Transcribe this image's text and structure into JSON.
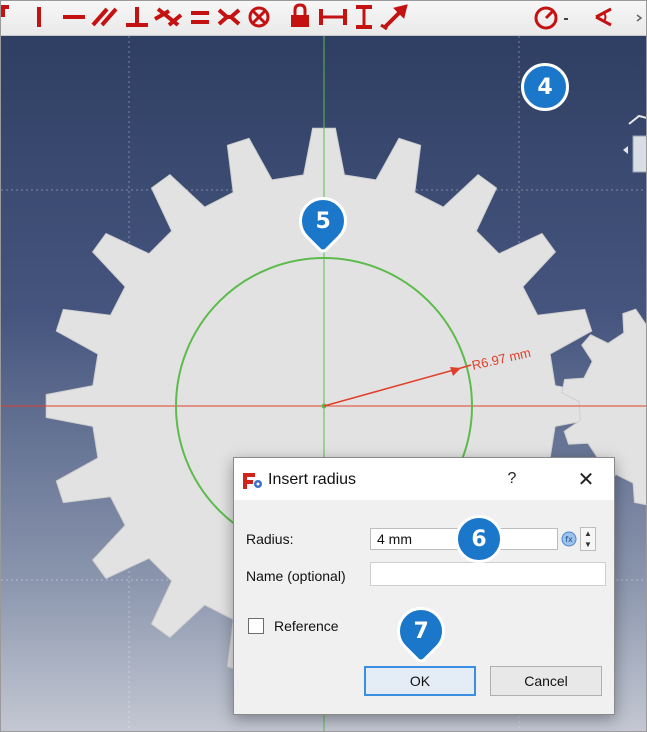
{
  "toolbar": {
    "icons": [
      "arc-fragment-icon",
      "vertical-constraint-icon",
      "horizontal-constraint-icon",
      "parallel-constraint-icon",
      "perpendicular-constraint-icon",
      "tangent-constraint-icon",
      "equal-constraint-icon",
      "symmetric-constraint-icon",
      "block-constraint-icon",
      "lock-constraint-icon",
      "horizontal-distance-icon",
      "vertical-distance-icon",
      "distance-constraint-icon",
      "radius-constraint-icon",
      "dropdown-arrow-icon",
      "angle-constraint-icon"
    ],
    "constraint_color": "#c41212"
  },
  "viewport": {
    "dimension_label": "R6.97 mm",
    "background_top": "#2f3f63",
    "background_bottom": "#c3c7d2",
    "gear_color": "#e2e2e2",
    "circle_color": "#5dbb4d",
    "dimension_color": "#e0402a"
  },
  "callouts": {
    "step4": "4",
    "step5": "5",
    "step6": "6",
    "step7": "7",
    "color": "#1a77c9"
  },
  "dialog": {
    "title": "Insert radius",
    "help_label": "?",
    "close_label": "✕",
    "radius_label": "Radius:",
    "radius_value": "4 mm",
    "name_label": "Name (optional)",
    "name_value": "",
    "reference_label": "Reference",
    "reference_checked": false,
    "ok_label": "OK",
    "cancel_label": "Cancel"
  }
}
